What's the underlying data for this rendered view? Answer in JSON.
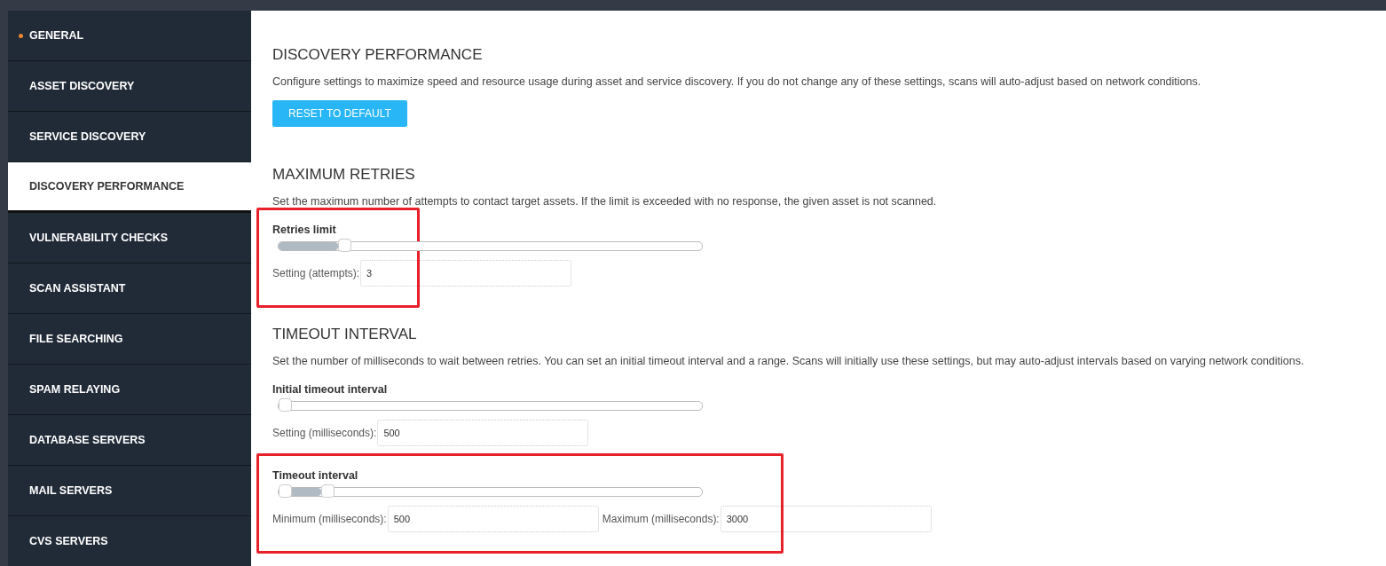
{
  "sidebar": {
    "items": [
      {
        "label": "GENERAL",
        "selected": false,
        "dot": true
      },
      {
        "label": "ASSET DISCOVERY",
        "selected": false,
        "dot": false
      },
      {
        "label": "SERVICE DISCOVERY",
        "selected": false,
        "dot": false
      },
      {
        "label": "DISCOVERY PERFORMANCE",
        "selected": true,
        "dot": false
      },
      {
        "label": "VULNERABILITY CHECKS",
        "selected": false,
        "dot": false
      },
      {
        "label": "SCAN ASSISTANT",
        "selected": false,
        "dot": false
      },
      {
        "label": "FILE SEARCHING",
        "selected": false,
        "dot": false
      },
      {
        "label": "SPAM RELAYING",
        "selected": false,
        "dot": false
      },
      {
        "label": "DATABASE SERVERS",
        "selected": false,
        "dot": false
      },
      {
        "label": "MAIL SERVERS",
        "selected": false,
        "dot": false
      },
      {
        "label": "CVS SERVERS",
        "selected": false,
        "dot": false
      }
    ]
  },
  "sections": [
    {
      "title": "DISCOVERY PERFORMANCE",
      "description": "Configure settings to maximize speed and resource usage during asset and service discovery. If you do not change any of these settings, scans will auto-adjust based on network conditions.",
      "button": "RESET TO DEFAULT"
    },
    {
      "title": "MAXIMUM RETRIES",
      "description": "Set the maximum number of attempts to contact target assets. If the limit is exceeded with no response, the given asset is not scanned.",
      "settings": [
        {
          "kind": "single",
          "label": "Retries limit",
          "highlighted": true,
          "thumbs": [
            {
              "level": 0.14
            }
          ],
          "fields": [
            {
              "label": "Setting (attempts):",
              "value": "3"
            }
          ]
        }
      ]
    },
    {
      "title": "TIMEOUT INTERVAL",
      "description": "Set the number of milliseconds to wait between retries. You can set an initial timeout interval and a range. Scans will initially use these settings, but may auto-adjust intervals based on varying network conditions.",
      "settings": [
        {
          "kind": "single",
          "label": "Initial timeout interval",
          "highlighted": false,
          "thumbs": [
            {
              "level": 0
            }
          ],
          "fields": [
            {
              "label": "Setting (milliseconds):",
              "value": "500"
            }
          ]
        },
        {
          "kind": "range",
          "label": "Timeout interval",
          "highlighted": true,
          "thumbs": [
            {
              "level": 0
            },
            {
              "level": 0.1
            }
          ],
          "fields": [
            {
              "label": "Minimum (milliseconds):",
              "value": "500"
            },
            {
              "label": "Maximum (milliseconds):",
              "value": "3000"
            }
          ]
        }
      ]
    }
  ]
}
